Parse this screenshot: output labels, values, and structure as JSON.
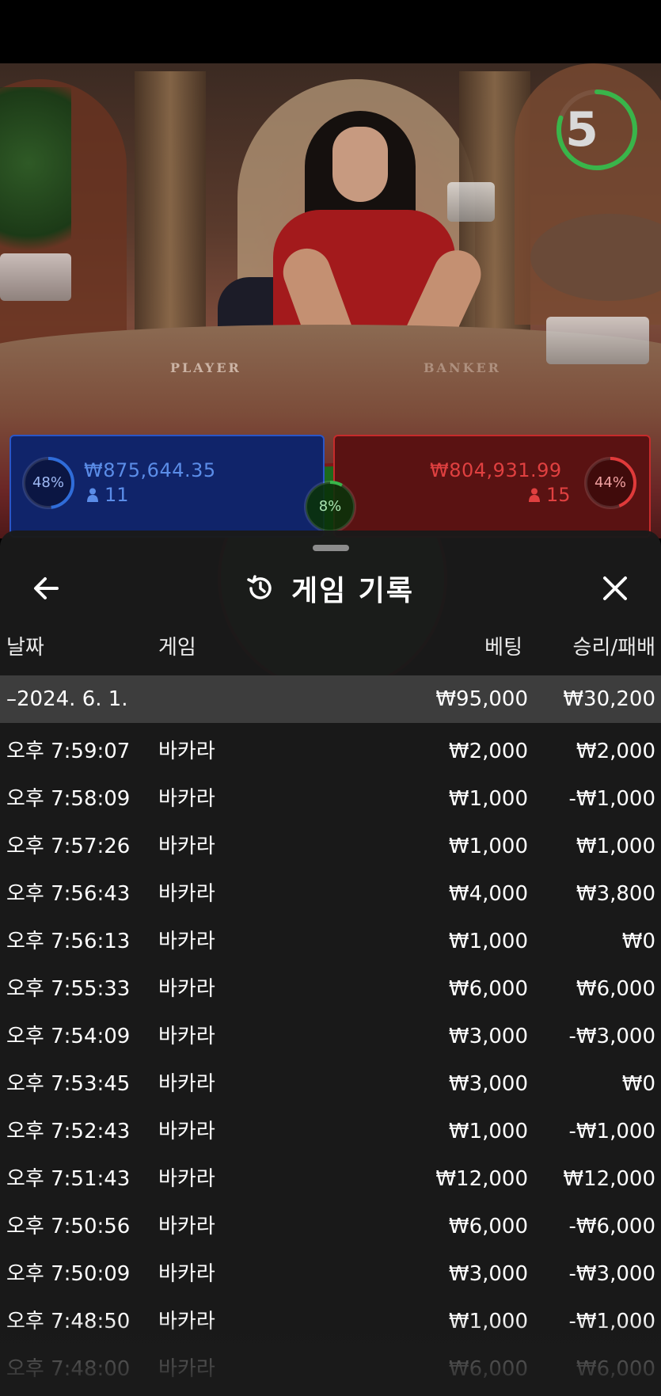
{
  "live_game": {
    "countdown": "5",
    "countdown_fraction": 0.8,
    "table_label_player": "PLAYER",
    "table_label_banker": "BANKER",
    "player": {
      "amount": "₩875,644.35",
      "players": "11",
      "percent_label": "48%",
      "percent": 48,
      "color": "#2f6cd9"
    },
    "banker": {
      "amount": "₩804,931.99",
      "players": "15",
      "percent_label": "44%",
      "percent": 44,
      "color": "#e03a3a"
    },
    "tie": {
      "percent_label": "8%",
      "percent": 8,
      "color": "#39b54a"
    }
  },
  "history": {
    "title": "게임 기록",
    "icons": {
      "back": "arrow-left-icon",
      "history": "history-icon",
      "close": "close-icon"
    },
    "columns": {
      "date": "날짜",
      "game": "게임",
      "bet": "베팅",
      "result": "승리/패배"
    },
    "summary": {
      "date": "–2024. 6. 1.",
      "bet": "₩95,000",
      "result": "₩30,200"
    },
    "rows": [
      {
        "time": "오후 7:59:07",
        "game": "바카라",
        "bet": "₩2,000",
        "result": "₩2,000"
      },
      {
        "time": "오후 7:58:09",
        "game": "바카라",
        "bet": "₩1,000",
        "result": "-₩1,000"
      },
      {
        "time": "오후 7:57:26",
        "game": "바카라",
        "bet": "₩1,000",
        "result": "₩1,000"
      },
      {
        "time": "오후 7:56:43",
        "game": "바카라",
        "bet": "₩4,000",
        "result": "₩3,800"
      },
      {
        "time": "오후 7:56:13",
        "game": "바카라",
        "bet": "₩1,000",
        "result": "₩0"
      },
      {
        "time": "오후 7:55:33",
        "game": "바카라",
        "bet": "₩6,000",
        "result": "₩6,000"
      },
      {
        "time": "오후 7:54:09",
        "game": "바카라",
        "bet": "₩3,000",
        "result": "-₩3,000"
      },
      {
        "time": "오후 7:53:45",
        "game": "바카라",
        "bet": "₩3,000",
        "result": "₩0"
      },
      {
        "time": "오후 7:52:43",
        "game": "바카라",
        "bet": "₩1,000",
        "result": "-₩1,000"
      },
      {
        "time": "오후 7:51:43",
        "game": "바카라",
        "bet": "₩12,000",
        "result": "₩12,000"
      },
      {
        "time": "오후 7:50:56",
        "game": "바카라",
        "bet": "₩6,000",
        "result": "-₩6,000"
      },
      {
        "time": "오후 7:50:09",
        "game": "바카라",
        "bet": "₩3,000",
        "result": "-₩3,000"
      },
      {
        "time": "오후 7:48:50",
        "game": "바카라",
        "bet": "₩1,000",
        "result": "-₩1,000"
      },
      {
        "time": "오후 7:48:00",
        "game": "바카라",
        "bet": "₩6,000",
        "result": "₩6,000"
      }
    ]
  }
}
